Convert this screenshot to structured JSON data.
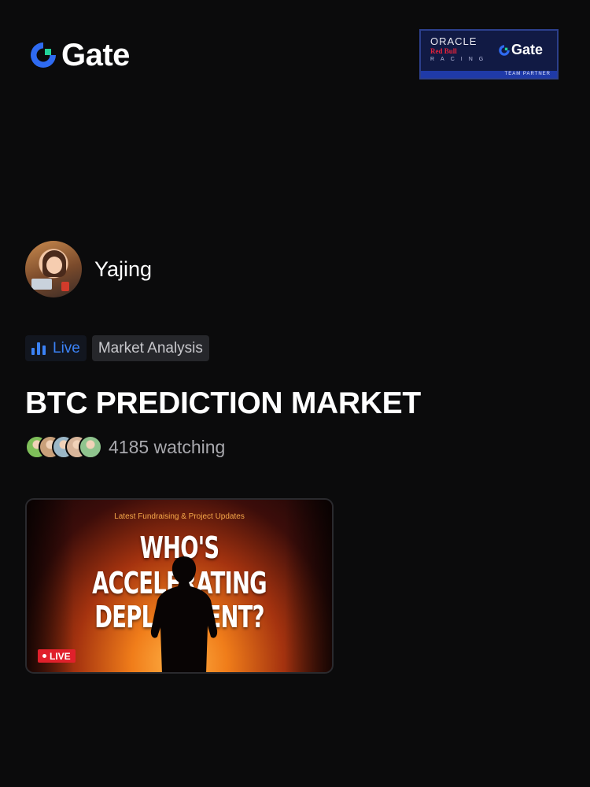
{
  "brand": {
    "name": "Gate",
    "logo_icon": "gate-logo-icon"
  },
  "partner_banner": {
    "oracle_text": "ORACLE",
    "redbull_text": "Red Bull",
    "racing_text": "RACING",
    "gate_text": "Gate",
    "footer_text": "TEAM PARTNER"
  },
  "host": {
    "name": "Yajing"
  },
  "tags": {
    "live_label": "Live",
    "category": "Market Analysis"
  },
  "stream": {
    "title": "BTC PREDICTION MARKET",
    "watching_label": "4185 watching",
    "viewer_avatar_colors": [
      "#7fbf5a",
      "#c9a07a",
      "#9bb7c7",
      "#d8b59a",
      "#8fc48e"
    ]
  },
  "thumbnail": {
    "subtitle": "Latest Fundraising & Project Updates",
    "line1": "WHO'S",
    "line2": "ACCELERATING",
    "line3": "DEPLOYMENT?",
    "live_badge": "LIVE"
  },
  "colors": {
    "accent": "#3b82f6",
    "live_red": "#e0202b",
    "background": "#0b0b0c"
  }
}
